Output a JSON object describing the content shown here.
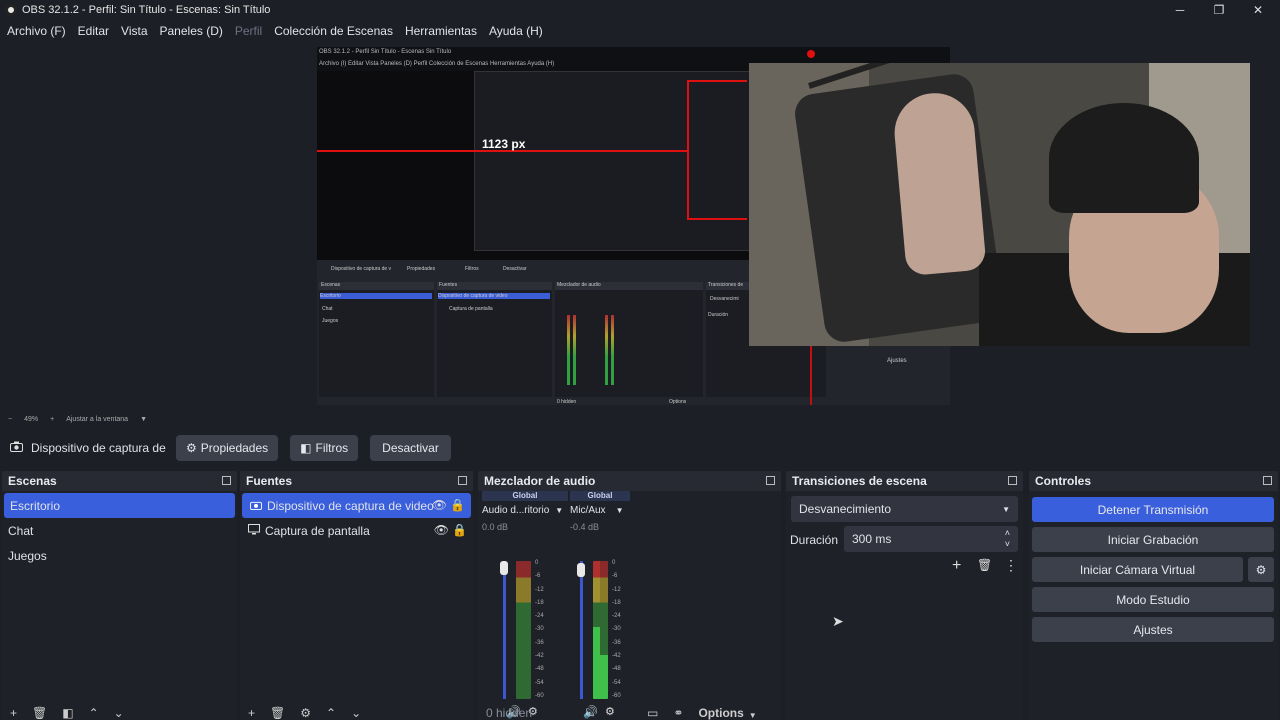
{
  "window": {
    "title": "OBS 32.1.2 - Perfil: Sin Título - Escenas: Sin Título",
    "minimize": "─",
    "maximize": "❐",
    "close": "✕"
  },
  "menu": [
    {
      "label": "Archivo (F)",
      "disabled": false
    },
    {
      "label": "Editar",
      "disabled": false
    },
    {
      "label": "Vista",
      "disabled": false
    },
    {
      "label": "Paneles (D)",
      "disabled": false
    },
    {
      "label": "Perfil",
      "disabled": true
    },
    {
      "label": "Colección de Escenas",
      "disabled": false
    },
    {
      "label": "Herramientas",
      "disabled": false
    },
    {
      "label": "Ayuda (H)",
      "disabled": false
    }
  ],
  "preview": {
    "nested_title": "OBS 32.1.2 - Perfil Sin Título - Escenas Sin Título",
    "nested_menu": "Archivo (I)   Editar   Vista   Paneles (D)   Perfil   Colección de Escenas   Herramientas   Ayuda (H)",
    "measure_label": "1123 px",
    "nested_source": "Dispositivo de captura de v",
    "nested_buttons": [
      "Propiedades",
      "Filtros",
      "Desactivar"
    ],
    "nested_docks": [
      "Escenas",
      "Fuentes",
      "Mezclador de audio",
      "Transiciones de"
    ],
    "nested_scenes": [
      "Escritorio",
      "Chat",
      "Juegos"
    ],
    "nested_sources": [
      "Dispositivo de captura de video",
      "Captura de pantalla"
    ],
    "nested_trans": "Desvanecimi",
    "nested_duration": "Duración",
    "nested_ajustes": "Ajustes",
    "nested_hidden": "0 hidden",
    "nested_options": "Options",
    "nested_zoom": "Ajustar a la ventana"
  },
  "previewbar": {
    "minus": "−",
    "zoom": "49%",
    "plus": "+",
    "fit": "Ajustar a la ventana",
    "caret": "▼"
  },
  "source_toolbar": {
    "source_name": "Dispositivo de captura de v",
    "properties": "Propiedades",
    "filters": "Filtros",
    "deactivate": "Desactivar"
  },
  "scenes": {
    "title": "Escenas",
    "items": [
      "Escritorio",
      "Chat",
      "Juegos"
    ],
    "selected": 0
  },
  "sources": {
    "title": "Fuentes",
    "items": [
      {
        "name": "Dispositivo de captura de video",
        "icon": "camera-icon",
        "selected": true
      },
      {
        "name": "Captura de pantalla",
        "icon": "monitor-icon",
        "selected": false
      }
    ]
  },
  "mixer": {
    "title": "Mezclador de audio",
    "channels": [
      {
        "global": "Global",
        "name": "Audio d...ritorio",
        "db": "0.0 dB",
        "level": 0.0
      },
      {
        "global": "Global",
        "name": "Mic/Aux",
        "db": "-0.4 dB",
        "level": 0.4
      }
    ],
    "scale": [
      "0",
      "-6",
      "-12",
      "-18",
      "-24",
      "-30",
      "-36",
      "-42",
      "-48",
      "-54",
      "-60"
    ],
    "hidden": "0 hidden",
    "options": "Options"
  },
  "transitions": {
    "title": "Transiciones de escena",
    "selected": "Desvanecimiento",
    "duration_label": "Duración",
    "duration_value": "300 ms"
  },
  "controls": {
    "title": "Controles",
    "stop_stream": "Detener Transmisión",
    "start_record": "Iniciar Grabación",
    "virtual_cam": "Iniciar Cámara Virtual",
    "studio_mode": "Modo Estudio",
    "settings": "Ajustes"
  },
  "colors": {
    "accent": "#3a5fdc",
    "background": "#1d1f26",
    "panel": "#272a33",
    "measure_red": "#e01010"
  }
}
